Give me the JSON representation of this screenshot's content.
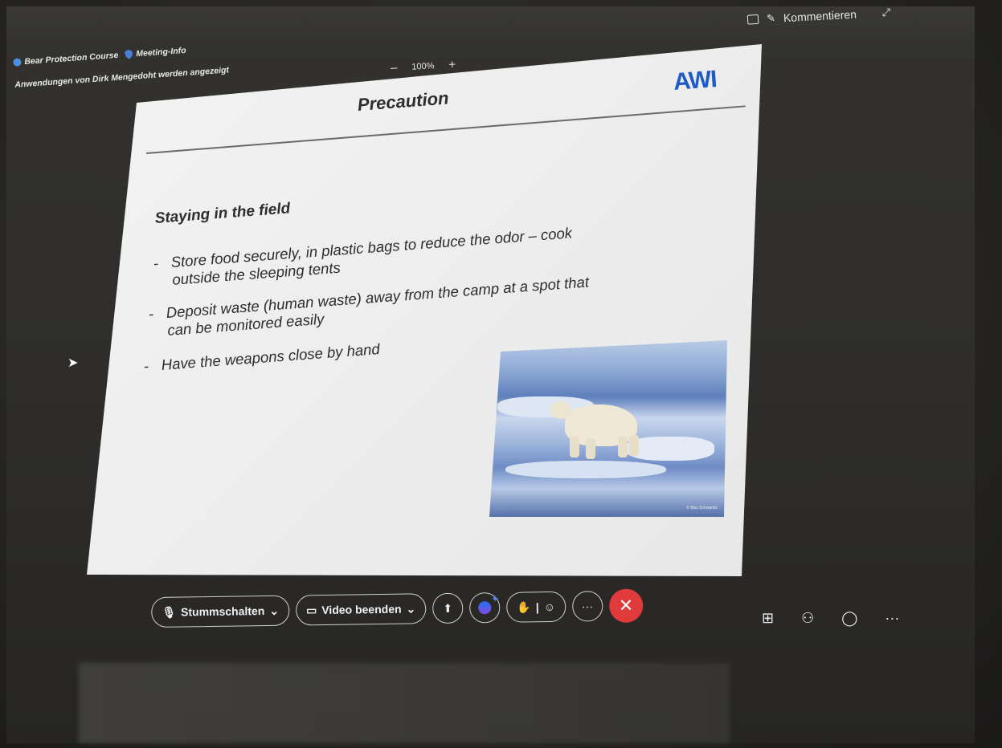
{
  "meeting": {
    "title": "Bear Protection Course",
    "info_label": "Meeting-Info",
    "sharing_notice": "Anwendungen von Dirk Mengedoht werden angezeigt"
  },
  "zoom": {
    "minus": "–",
    "value": "100%",
    "plus": "+"
  },
  "top_right": {
    "comment_label": "Kommentieren"
  },
  "slide": {
    "logo": "AWI",
    "title": "Precaution",
    "section": "Staying in the field",
    "bullets": [
      "Store food securely, in plastic bags to reduce the odor – cook",
      "outside the sleeping tents",
      "Deposit waste (human waste) away from the camp at a spot that",
      "can be monitored easily",
      "Have the weapons close by hand"
    ],
    "photo_credit": "© Max Schwanitz"
  },
  "controls": {
    "mute_label": "Stummschalten",
    "video_label": "Video beenden",
    "more": "···",
    "end": "✕"
  },
  "icons": {
    "apps": "apps-add-icon",
    "people": "people-icon",
    "chat": "chat-icon",
    "more": "more-icon"
  },
  "colors": {
    "end_call": "#e03a3a",
    "brand": "#1e5bc6"
  }
}
